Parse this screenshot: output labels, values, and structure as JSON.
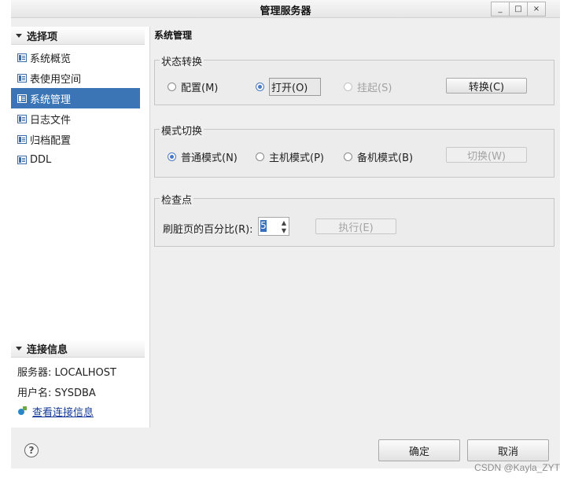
{
  "window": {
    "title": "管理服务器",
    "controls": [
      "_",
      "□",
      "×"
    ]
  },
  "sidebar": {
    "section_title": "选择项",
    "items": [
      {
        "label": "系统概览",
        "icon": "table-icon"
      },
      {
        "label": "表使用空间",
        "icon": "table-icon"
      },
      {
        "label": "系统管理",
        "icon": "table-icon",
        "selected": true
      },
      {
        "label": "日志文件",
        "icon": "table-icon"
      },
      {
        "label": "归档配置",
        "icon": "table-icon"
      },
      {
        "label": "DDL",
        "icon": "table-icon"
      }
    ],
    "connection": {
      "title": "连接信息",
      "server": "服务器: LOCALHOST",
      "user": "用户名: SYSDBA",
      "view_link": "查看连接信息"
    }
  },
  "main": {
    "title": "系统管理",
    "state_group": {
      "label": "状态转换",
      "options": [
        {
          "label": "配置(M)",
          "checked": false,
          "enabled": true
        },
        {
          "label": "打开(O)",
          "checked": true,
          "enabled": true
        },
        {
          "label": "挂起(S)",
          "checked": false,
          "enabled": false
        }
      ],
      "button": "转换(C)"
    },
    "mode_group": {
      "label": "模式切换",
      "options": [
        {
          "label": "普通模式(N)",
          "checked": true,
          "enabled": true
        },
        {
          "label": "主机模式(P)",
          "checked": false,
          "enabled": true
        },
        {
          "label": "备机模式(B)",
          "checked": false,
          "enabled": true
        }
      ],
      "button": "切换(W)"
    },
    "checkpoint_group": {
      "label": "检查点",
      "field_label": "刷脏页的百分比(R):",
      "value": "5",
      "button": "执行(E)"
    }
  },
  "footer": {
    "help": "?",
    "ok": "确定",
    "cancel": "取消"
  },
  "watermark": "CSDN @Kayla_ZYT"
}
